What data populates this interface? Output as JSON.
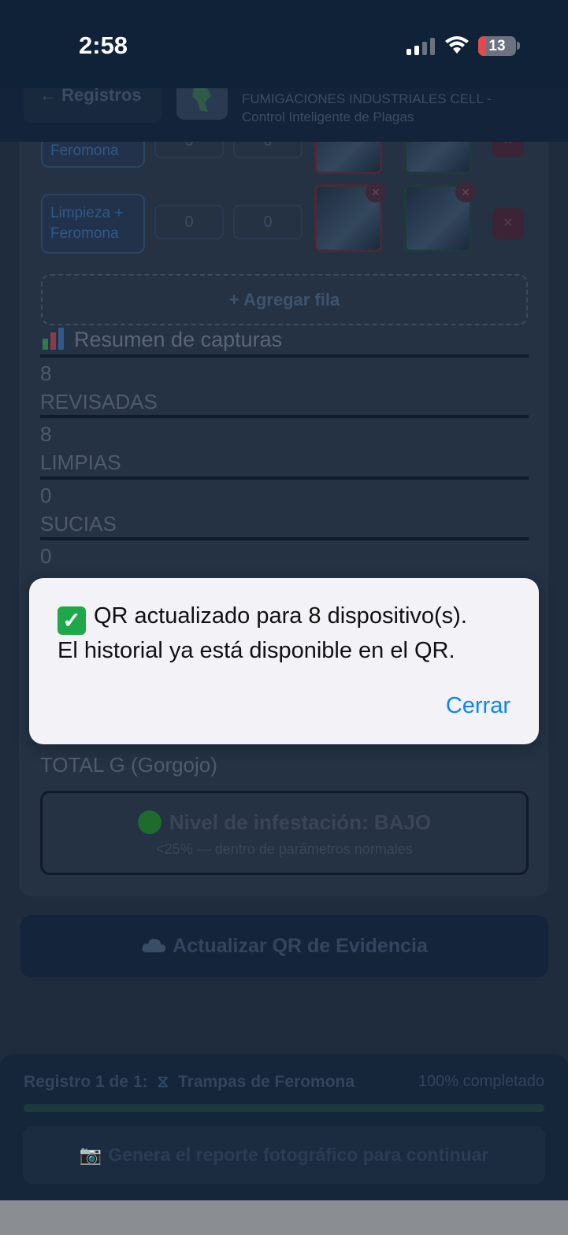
{
  "status_bar": {
    "time": "2:58",
    "battery": "13"
  },
  "header": {
    "back_label": "← Registros",
    "company_line1": "FUMIGACIONES INDUSTRIALES CELL -",
    "company_line2": "Control Inteligente de Plagas"
  },
  "rows": [
    {
      "type": "Feromona",
      "v1": "0",
      "v2": "0"
    },
    {
      "type_line1": "Limpieza +",
      "type_line2": "Feromona",
      "v1": "0",
      "v2": "0"
    }
  ],
  "add_row_label": "+ Agregar fila",
  "summary": {
    "title": "Resumen de capturas",
    "stats": [
      {
        "value": "8",
        "label": "REVISADAS"
      },
      {
        "value": "8",
        "label": "LIMPIAS"
      },
      {
        "value": "0",
        "label": "SUCIAS"
      },
      {
        "value": "0"
      }
    ]
  },
  "total_g_label": "TOTAL G (Gorgojo)",
  "infestation": {
    "title": "Nivel de infestación: BAJO",
    "subtitle": "<25% — dentro de parámetros normales"
  },
  "update_button": "Actualizar QR de Evidencia",
  "bottom": {
    "registro_label": "Registro 1 de 1:",
    "registro_name": "Trampas de Feromona",
    "percent": "100% completado",
    "progress": 1.0,
    "report_button": "Genera el reporte fotográfico para continuar"
  },
  "dialog": {
    "line1": "QR actualizado para 8 dispositivo(s).",
    "line2": "El historial ya está disponible en el QR.",
    "close": "Cerrar"
  },
  "colors": {
    "accent": "#0a84ff",
    "success": "#1fa84a",
    "battery_low": "#e5484d"
  }
}
